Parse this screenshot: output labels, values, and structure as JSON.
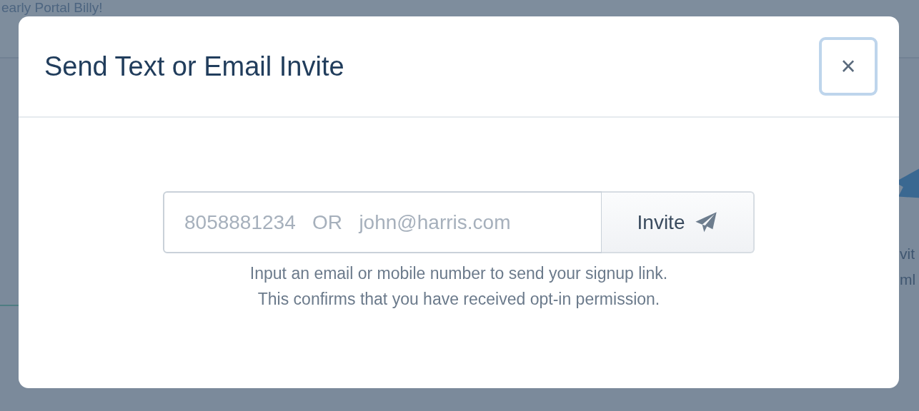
{
  "background": {
    "heading": "early Portal Billy!",
    "side_texts": [
      "vit",
      "ml"
    ]
  },
  "modal": {
    "title": "Send Text or Email Invite",
    "close": "×",
    "input": {
      "placeholder": "8058881234   OR   john@harris.com"
    },
    "button": {
      "label": "Invite"
    },
    "help": [
      "Input an email or mobile number to send your signup link.",
      "This confirms that you have received opt-in permission."
    ]
  }
}
